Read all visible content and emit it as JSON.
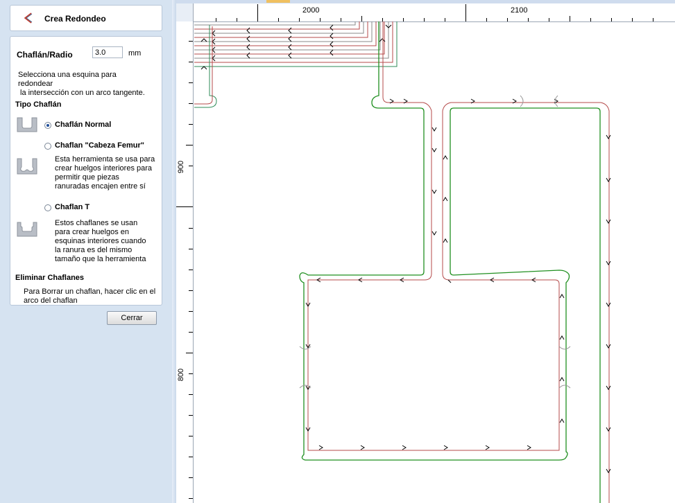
{
  "panel": {
    "title": "Crea Redondeo",
    "radius_label": "Chaflán/Radio",
    "radius_value": "3.0",
    "radius_unit": "mm",
    "instruction_1": "Selecciona una esquina para",
    "instruction_2": "redondear",
    "instruction_3": "la intersección con un arco tangente.",
    "type_heading": "Tipo Chaflán",
    "options": [
      {
        "label": "Chaflán Normal",
        "selected": true,
        "description": []
      },
      {
        "label": "Chaflan \"Cabeza Femur\"",
        "selected": false,
        "description": [
          "Esta herramienta se usa para",
          "crear huelgos interiores para",
          "permitir que piezas",
          "ranuradas encajen entre sí"
        ]
      },
      {
        "label": "Chaflan T",
        "selected": false,
        "description": [
          "Estos chaflanes se usan",
          "para crear  huelgos en",
          "esquinas interiores cuando",
          "la ranura es del mismo",
          "tamaño que la herramienta"
        ]
      }
    ],
    "remove_heading": "Eliminar Chaflanes",
    "remove_text_1": "Para Borrar un chaflan, hacer clic en el",
    "remove_text_2": "arco del chaflan",
    "close_label": "Cerrar"
  },
  "rulers": {
    "top_labels": [
      "2000",
      "2100"
    ],
    "left_labels": [
      "900",
      "800"
    ]
  },
  "colors": {
    "panel_bg": "#d6e3f1",
    "geometry": "#1f8f1f",
    "toolpath": "#b44a4a"
  }
}
